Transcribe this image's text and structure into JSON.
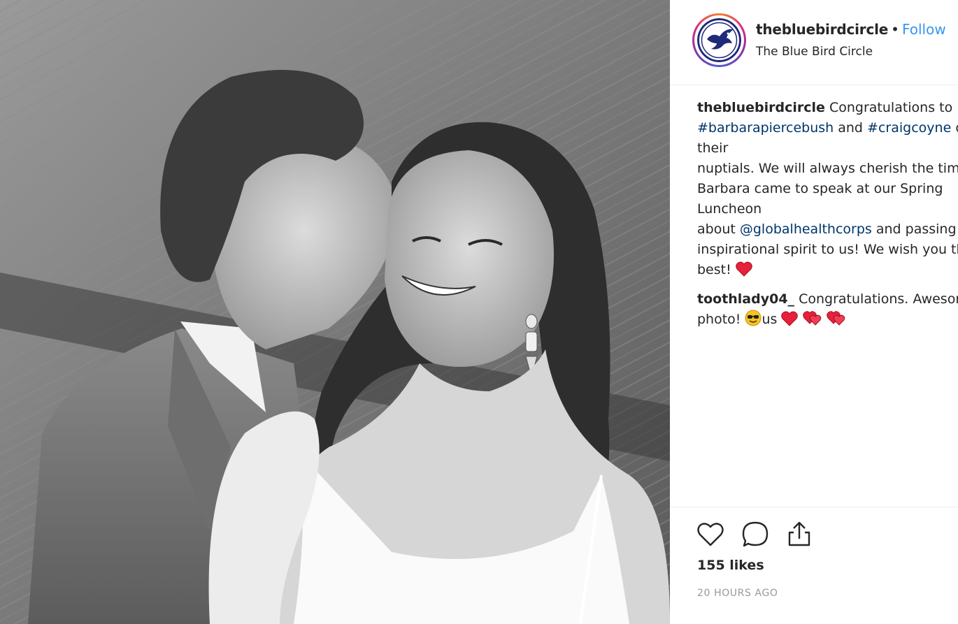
{
  "photo": {
    "kind": "black-and-white wedding portrait"
  },
  "post": {
    "username": "thebluebirdcircle",
    "separator": "•",
    "follow_label": "Follow",
    "location": "The Blue Bird Circle",
    "avatar_icon": "bluebird-logo-icon"
  },
  "caption": {
    "username": "thebluebirdcircle",
    "text_1": "Congratulations to",
    "tag_1": "#barbarapiercebush",
    "text_2": "and",
    "tag_2": "#craigcoyne",
    "text_3": "on their",
    "text_4": "nuptials. We will always cherish the time",
    "text_5": "Barbara came to speak at our Spring Luncheon",
    "text_6": "about",
    "mention": "@globalhealthcorps",
    "text_7": "and passing her",
    "text_8": "inspirational spirit to us! We wish you the",
    "text_9": "best!"
  },
  "comment_1": {
    "username": "toothlady04_",
    "text_1": "Congratulations. Awesome",
    "text_2": "photo!",
    "text_3": "us"
  },
  "actions": {
    "like_icon": "heart-outline-icon",
    "comment_icon": "comment-icon",
    "share_icon": "share-icon"
  },
  "likes": "155 likes",
  "timestamp": "20 HOURS AGO",
  "colors": {
    "follow": "#3897f0",
    "hashtag": "#003569",
    "timestamp": "#999999",
    "brand_blue": "#1f2a7a"
  }
}
